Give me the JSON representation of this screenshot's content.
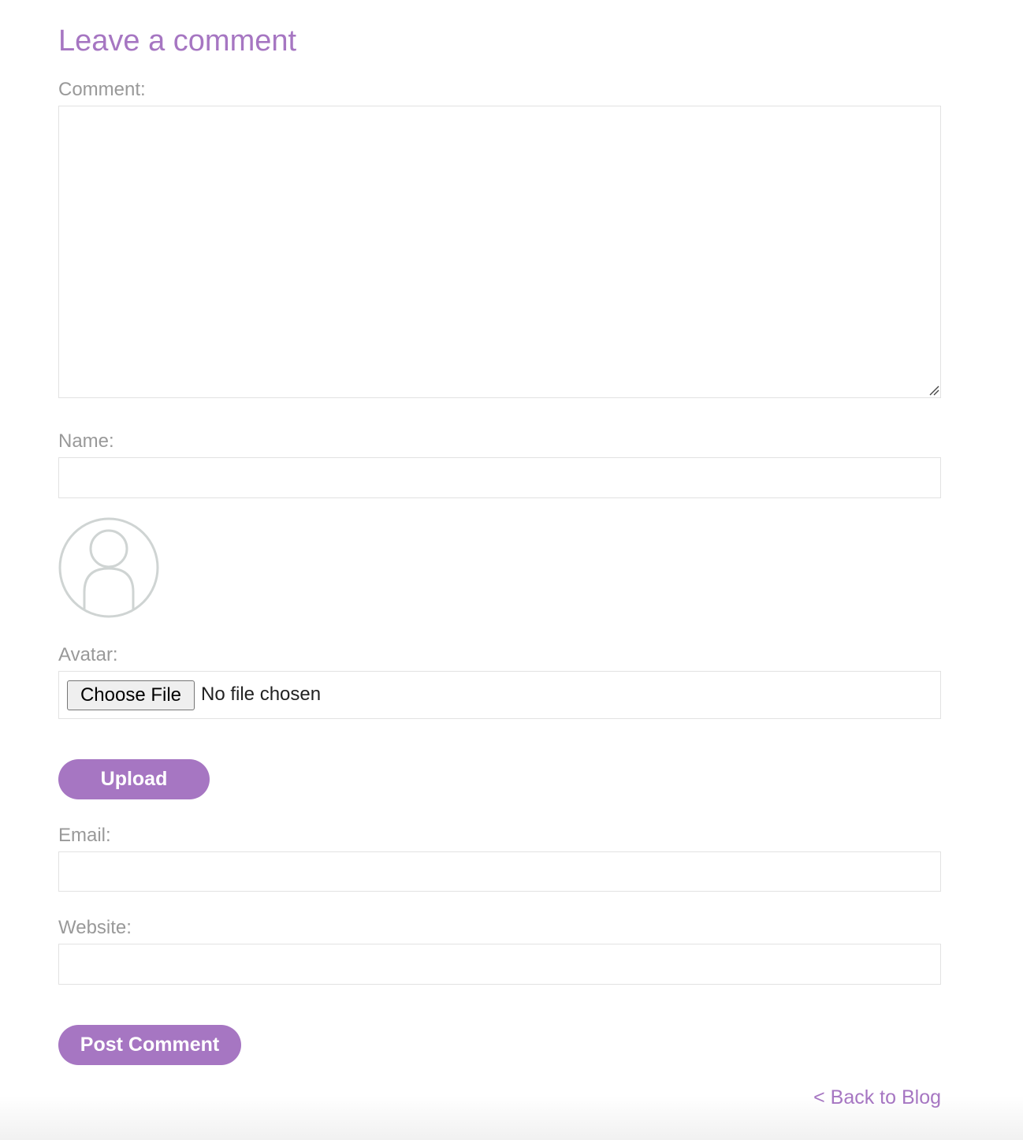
{
  "form": {
    "title": "Leave a comment",
    "comment_label": "Comment:",
    "comment_value": "",
    "name_label": "Name:",
    "name_value": "",
    "avatar_label": "Avatar:",
    "choose_file_label": "Choose File",
    "no_file_text": "No file chosen",
    "upload_label": "Upload",
    "email_label": "Email:",
    "email_value": "",
    "website_label": "Website:",
    "website_value": "",
    "post_label": "Post Comment"
  },
  "nav": {
    "back_label": "< Back to Blog"
  },
  "colors": {
    "accent": "#a676c2",
    "label_gray": "#999999",
    "field_border": "#e2e2e2",
    "avatar_gray": "#cfd4d3"
  },
  "icons": {
    "avatar": "user-avatar-placeholder-icon",
    "resize": "resize-grip-icon"
  }
}
